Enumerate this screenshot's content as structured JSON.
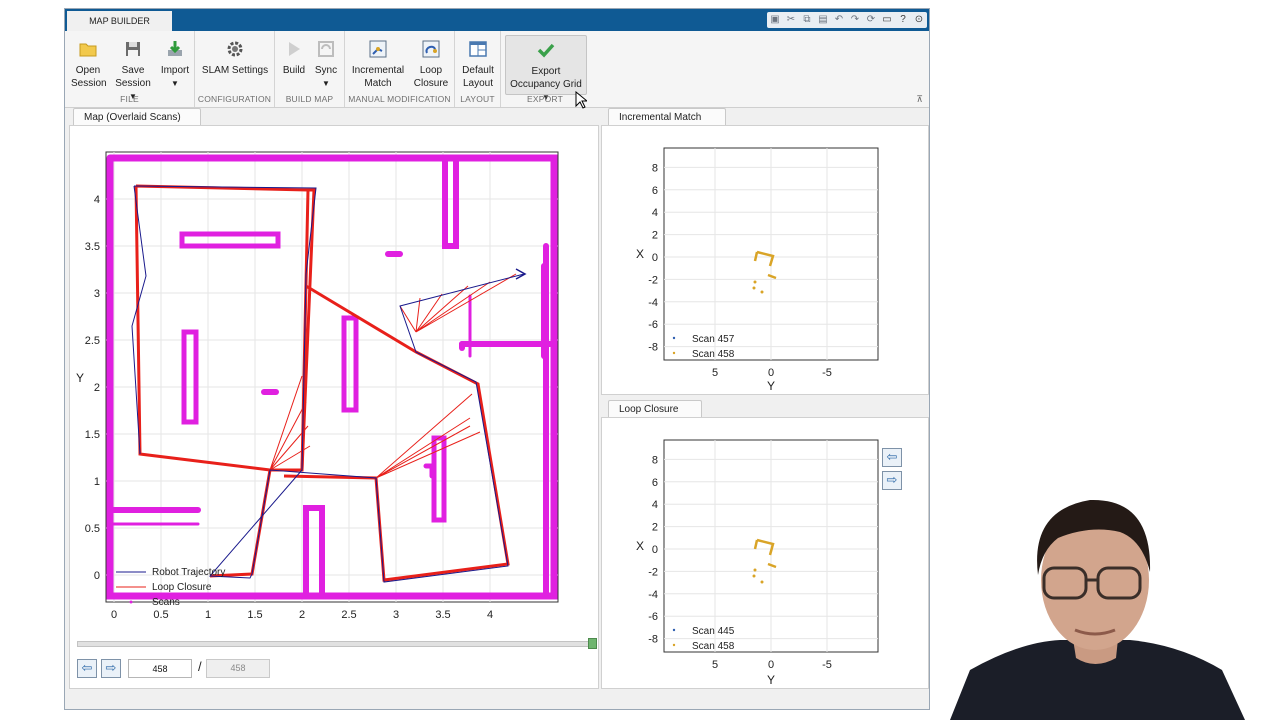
{
  "app": {
    "tab_title": "MAP BUILDER"
  },
  "ribbon": {
    "groups": {
      "file": "FILE",
      "configuration": "CONFIGURATION",
      "build_map": "BUILD MAP",
      "manual_modification": "MANUAL MODIFICATION",
      "layout": "LAYOUT",
      "export": "EXPORT"
    },
    "buttons": {
      "open_l1": "Open",
      "open_l2": "Session",
      "save_l1": "Save",
      "save_l2": "Session",
      "import_l1": "Import",
      "slam_settings": "SLAM Settings",
      "build": "Build",
      "sync": "Sync",
      "incremental_l1": "Incremental",
      "incremental_l2": "Match",
      "loop_l1": "Loop",
      "loop_l2": "Closure",
      "default_l1": "Default",
      "default_l2": "Layout",
      "export_l1": "Export",
      "export_l2": "Occupancy Grid"
    }
  },
  "map_panel": {
    "tab": "Map (Overlaid Scans)",
    "xlabel": "X",
    "ylabel": "Y",
    "xticks": [
      "0",
      "0.5",
      "1",
      "1.5",
      "2",
      "2.5",
      "3",
      "3.5",
      "4"
    ],
    "yticks": [
      "0",
      "0.5",
      "1",
      "1.5",
      "2",
      "2.5",
      "3",
      "3.5",
      "4"
    ],
    "legend": [
      "Robot Trajectory",
      "Loop Closure",
      "Scans"
    ]
  },
  "incremental_panel": {
    "tab": "Incremental Match",
    "xlabel": "Y",
    "ylabel": "X",
    "xticks": [
      "5",
      "0",
      "-5"
    ],
    "yticks": [
      "8",
      "6",
      "4",
      "2",
      "0",
      "-2",
      "-4",
      "-6",
      "-8"
    ],
    "legend": [
      "Scan 457",
      "Scan 458"
    ]
  },
  "loop_panel": {
    "tab": "Loop Closure",
    "xlabel": "Y",
    "ylabel": "X",
    "xticks": [
      "5",
      "0",
      "-5"
    ],
    "yticks": [
      "8",
      "6",
      "4",
      "2",
      "0",
      "-2",
      "-4",
      "-6",
      "-8"
    ],
    "legend": [
      "Scan 445",
      "Scan 458"
    ]
  },
  "scan_nav": {
    "current": "458",
    "separator": "/",
    "total": "458",
    "slider_fraction": 1.0
  },
  "colors": {
    "titlebar": "#0f5a94",
    "trajectory": "#1a1a8c",
    "loop_closure": "#e8201a",
    "scans": "#e020e0",
    "scan_a": "#2f5fb0",
    "scan_b": "#d9a427"
  }
}
